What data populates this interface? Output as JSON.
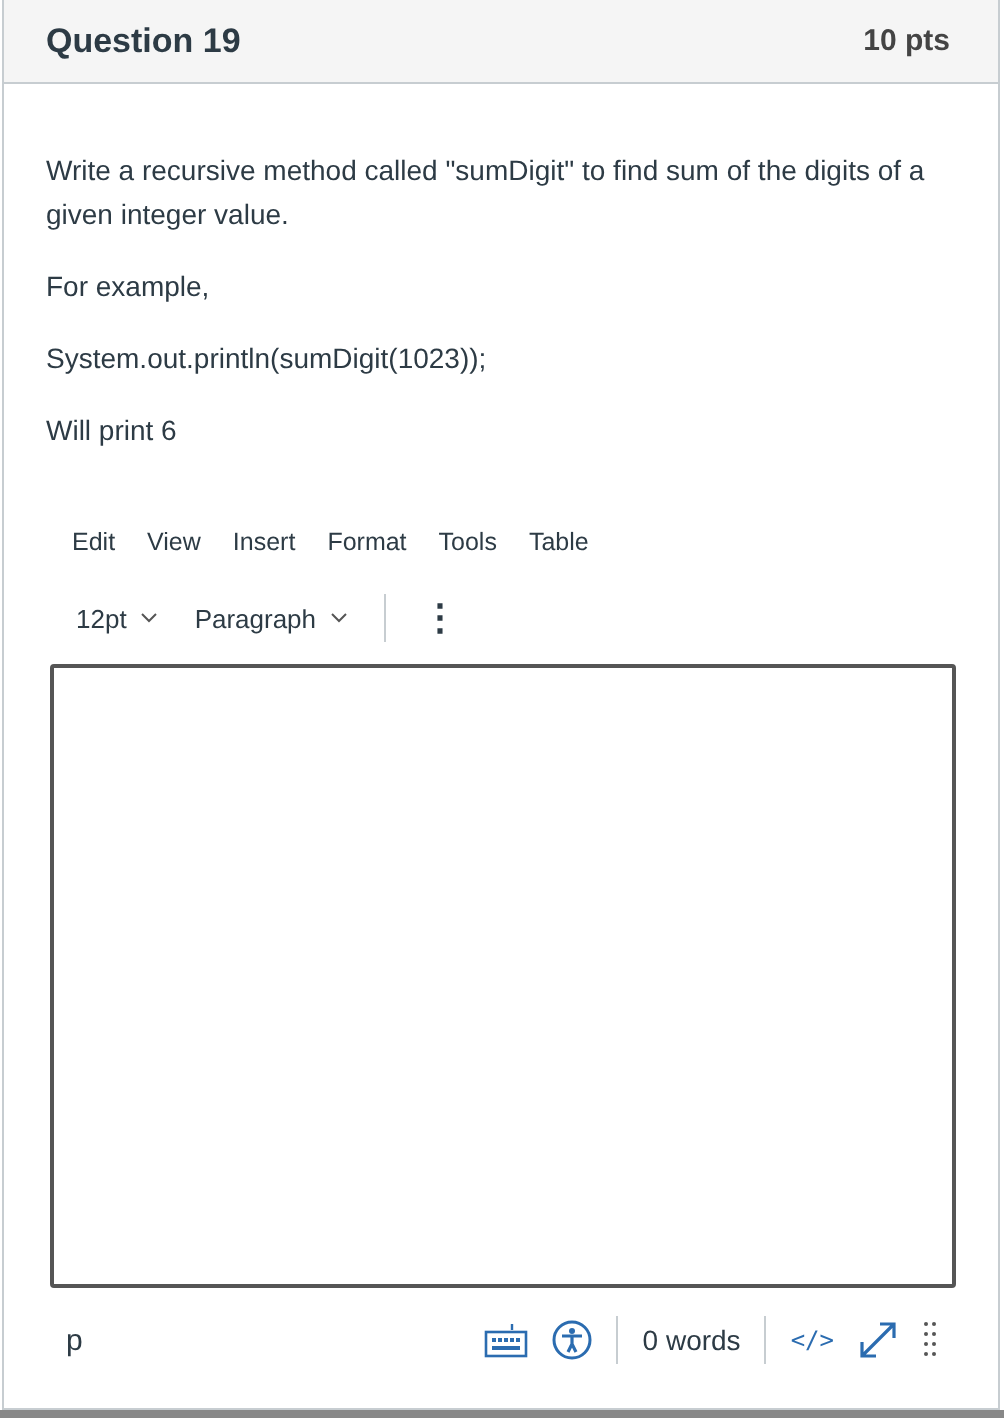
{
  "question": {
    "title": "Question 19",
    "points": "10 pts"
  },
  "prompt": [
    "Write a recursive method called \"sumDigit\" to find sum of the digits of a given integer value.",
    "For example,",
    "System.out.println(sumDigit(1023));",
    "Will print 6"
  ],
  "menu": [
    "Edit",
    "View",
    "Insert",
    "Format",
    "Tools",
    "Table"
  ],
  "toolbar": {
    "font_size": "12pt",
    "block_format": "Paragraph",
    "more": "⋮"
  },
  "status_bar": {
    "path": "p",
    "word_count": "0 words",
    "html_editor": "</>"
  }
}
